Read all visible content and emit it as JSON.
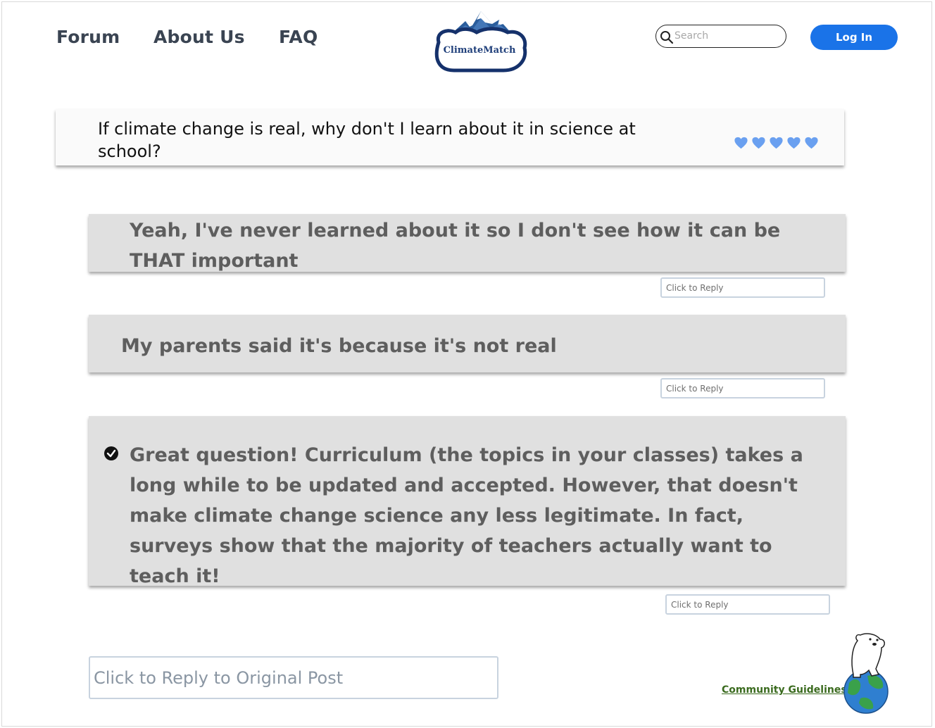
{
  "nav": {
    "forum": "Forum",
    "about": "About Us",
    "faq": "FAQ"
  },
  "logo": {
    "text": "ClimateMatch"
  },
  "search": {
    "placeholder": "Search"
  },
  "login": {
    "label": "Log In"
  },
  "original_post": {
    "question": "If climate change is real, why don't I learn about it in science at school?",
    "likes": 5
  },
  "replies": [
    {
      "text": "Yeah, I've never learned about it so I don't see how it can be THAT important",
      "reply_placeholder": "Click to Reply",
      "verified": false
    },
    {
      "text": "My parents said it's because it's not real",
      "reply_placeholder": "Click to Reply",
      "verified": false
    },
    {
      "text": "Great question! Curriculum (the topics in your classes) takes a long while to be updated and accepted. However, that doesn't make climate change science any less legitimate. In fact, surveys show that the majority of teachers actually want to teach it!",
      "reply_placeholder": "Click to Reply",
      "verified": true
    }
  ],
  "reply_original": {
    "placeholder": "Click to Reply to Original Post"
  },
  "footer": {
    "guidelines": "Community Guidelines"
  },
  "colors": {
    "accent": "#1a73e8",
    "heart": "#6aa0f0",
    "card": "#e0e0e0",
    "guidelines": "#3b6b1f"
  }
}
